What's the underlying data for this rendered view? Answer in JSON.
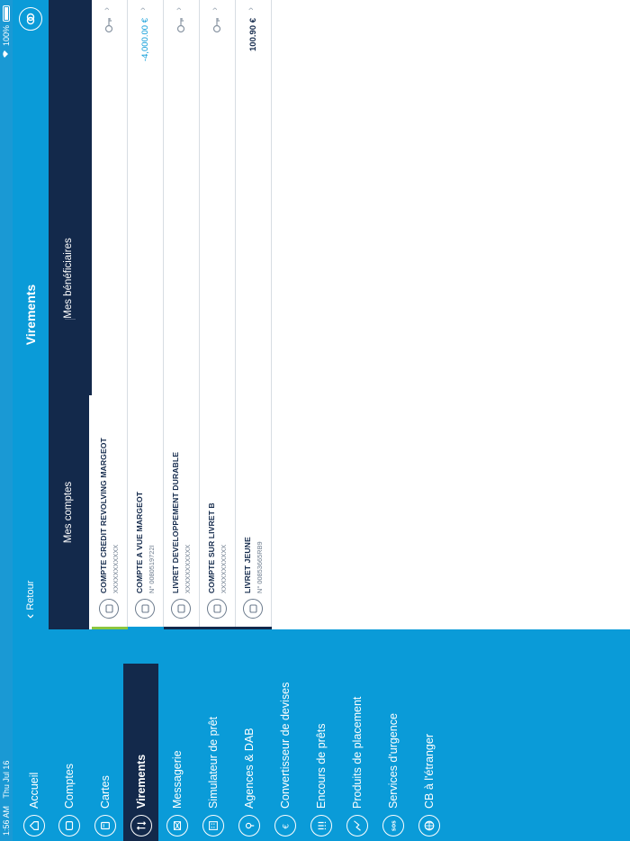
{
  "status_bar": {
    "time": "1:56 AM",
    "date": "Thu Jul 16",
    "battery": "100%"
  },
  "sidebar": {
    "items": [
      {
        "label": "Accueil",
        "icon": "home-icon"
      },
      {
        "label": "Comptes",
        "icon": "wallet-icon"
      },
      {
        "label": "Cartes",
        "icon": "card-icon"
      },
      {
        "label": "Virements",
        "icon": "transfer-icon",
        "active": true
      },
      {
        "label": "Messagerie",
        "icon": "mail-icon"
      },
      {
        "label": "Simulateur de prêt",
        "icon": "calculator-icon"
      },
      {
        "label": "Agences & DAB",
        "icon": "location-icon"
      },
      {
        "label": "Convertisseur de devises",
        "icon": "euro-icon"
      },
      {
        "label": "Encours de prêts",
        "icon": "list-icon"
      },
      {
        "label": "Produits de placement",
        "icon": "chart-icon"
      },
      {
        "label": "Services d'urgence",
        "icon": "sos-icon"
      },
      {
        "label": "CB à l'étranger",
        "icon": "globe-icon"
      }
    ]
  },
  "header": {
    "back_label": "Retour",
    "title": "Virements"
  },
  "tabs": [
    {
      "label": "Mes comptes",
      "active": true
    },
    {
      "label": "Mes bénéficiaires",
      "active": false
    }
  ],
  "accounts": [
    {
      "name": "COMPTE CREDIT REVOLVING MARGEOT",
      "number": "XXXXXXXXXXX",
      "amount": "",
      "strip_color": "#8cc63f",
      "key": true
    },
    {
      "name": "COMPTE A VUE MARGEOT",
      "number": "N° 0080519722I",
      "amount": "-4,000.00 €",
      "amount_type": "neg",
      "strip_color": "#0a9bd8",
      "key": false
    },
    {
      "name": "LIVRET DEVELOPPEMENT DURABLE",
      "number": "XXXXXXXXXXX",
      "amount": "",
      "strip_color": "#13294b",
      "key": true
    },
    {
      "name": "COMPTE SUR LIVRET B",
      "number": "XXXXXXXXXXX",
      "amount": "",
      "strip_color": "#13294b",
      "key": true
    },
    {
      "name": "LIVRET JEUNE",
      "number": "N° 00853665RB9",
      "amount": "100.90 €",
      "amount_type": "pos",
      "strip_color": "#13294b",
      "key": false
    }
  ],
  "colors": {
    "primary": "#0a9bd8",
    "dark": "#13294b",
    "green": "#8cc63f"
  }
}
